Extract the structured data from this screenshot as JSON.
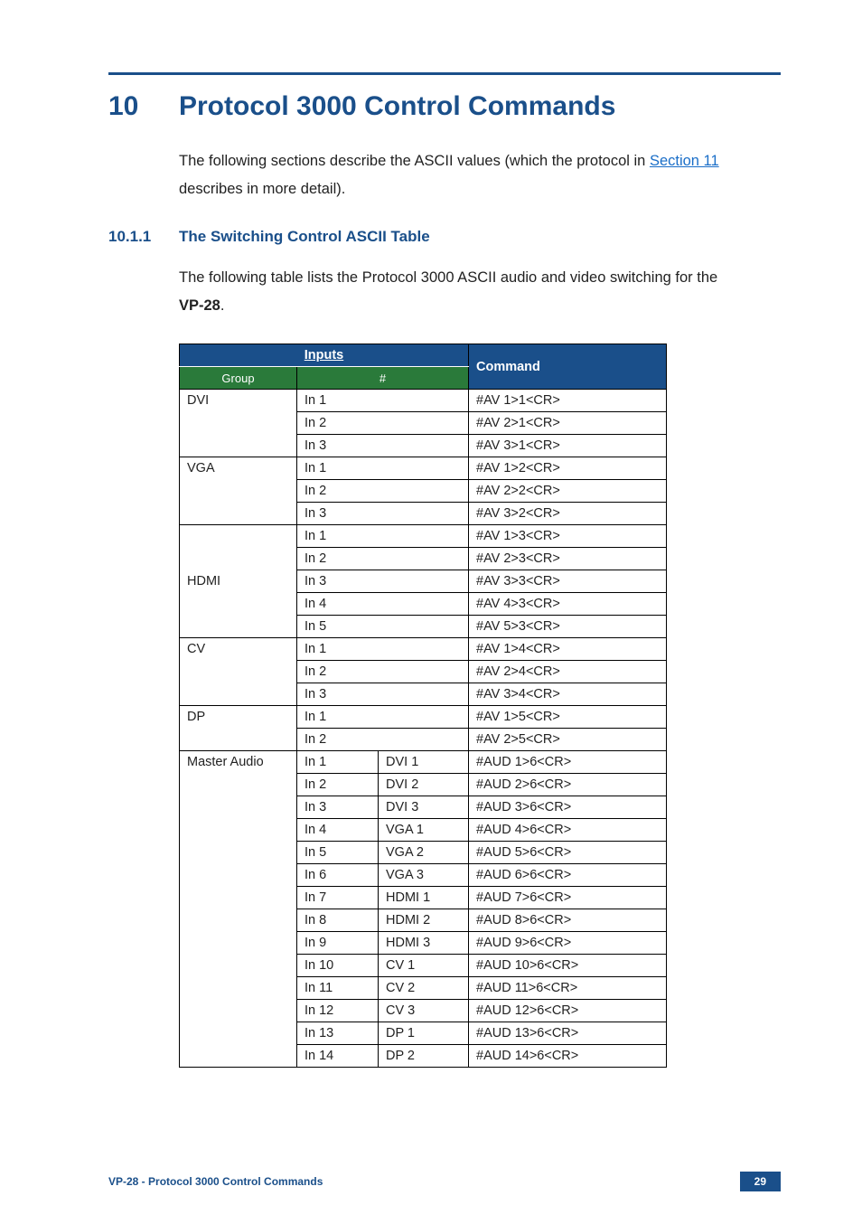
{
  "heading": {
    "num": "10",
    "title": "Protocol 3000 Control Commands"
  },
  "intro": {
    "part1": "The following sections describe the ASCII values (which the protocol in ",
    "link": "Section 11",
    "part2": " describes in more detail)."
  },
  "subheading": {
    "num": "10.1.1",
    "title": "The Switching Control ASCII Table"
  },
  "subintro": {
    "line1": "The following table lists the Protocol 3000 ASCII audio and video switching for the ",
    "bold": "VP-28",
    "dot": "."
  },
  "table": {
    "headers": {
      "inputs": "Inputs",
      "command": "Command",
      "group": "Group",
      "hash": "#"
    },
    "groups": [
      {
        "name": "DVI",
        "rows": [
          {
            "in": "In 1",
            "sub": "",
            "cmd": "#AV 1>1<CR>"
          },
          {
            "in": "In 2",
            "sub": "",
            "cmd": "#AV 2>1<CR>"
          },
          {
            "in": "In 3",
            "sub": "",
            "cmd": "#AV 3>1<CR>"
          }
        ]
      },
      {
        "name": "VGA",
        "rows": [
          {
            "in": "In 1",
            "sub": "",
            "cmd": "#AV 1>2<CR>"
          },
          {
            "in": "In 2",
            "sub": "",
            "cmd": "#AV 2>2<CR>"
          },
          {
            "in": "In 3",
            "sub": "",
            "cmd": "#AV 3>2<CR>"
          }
        ]
      },
      {
        "name": "HDMI",
        "rows": [
          {
            "in": "In 1",
            "sub": "",
            "cmd": "#AV 1>3<CR>"
          },
          {
            "in": "In 2",
            "sub": "",
            "cmd": "#AV 2>3<CR>"
          },
          {
            "in": "In 3",
            "sub": "",
            "cmd": "#AV 3>3<CR>"
          },
          {
            "in": "In 4",
            "sub": "",
            "cmd": "#AV 4>3<CR>"
          },
          {
            "in": "In 5",
            "sub": "",
            "cmd": "#AV 5>3<CR>"
          }
        ]
      },
      {
        "name": "CV",
        "rows": [
          {
            "in": "In 1",
            "sub": "",
            "cmd": "#AV 1>4<CR>"
          },
          {
            "in": "In 2",
            "sub": "",
            "cmd": "#AV 2>4<CR>"
          },
          {
            "in": "In 3",
            "sub": "",
            "cmd": "#AV 3>4<CR>"
          }
        ]
      },
      {
        "name": "DP",
        "rows": [
          {
            "in": "In 1",
            "sub": "",
            "cmd": "#AV 1>5<CR>"
          },
          {
            "in": "In 2",
            "sub": "",
            "cmd": "#AV 2>5<CR>"
          }
        ]
      },
      {
        "name": "Master Audio",
        "rows": [
          {
            "in": "In 1",
            "sub": "DVI 1",
            "cmd": "#AUD 1>6<CR>"
          },
          {
            "in": "In 2",
            "sub": "DVI 2",
            "cmd": "#AUD 2>6<CR>"
          },
          {
            "in": "In 3",
            "sub": "DVI 3",
            "cmd": "#AUD 3>6<CR>"
          },
          {
            "in": "In 4",
            "sub": "VGA 1",
            "cmd": "#AUD 4>6<CR>"
          },
          {
            "in": "In 5",
            "sub": "VGA 2",
            "cmd": "#AUD 5>6<CR>"
          },
          {
            "in": "In 6",
            "sub": "VGA 3",
            "cmd": "#AUD 6>6<CR>"
          },
          {
            "in": "In 7",
            "sub": "HDMI 1",
            "cmd": "#AUD 7>6<CR>"
          },
          {
            "in": "In 8",
            "sub": "HDMI 2",
            "cmd": "#AUD 8>6<CR>"
          },
          {
            "in": "In 9",
            "sub": "HDMI 3",
            "cmd": "#AUD 9>6<CR>"
          },
          {
            "in": "In 10",
            "sub": "CV 1",
            "cmd": "#AUD 10>6<CR>"
          },
          {
            "in": "In 11",
            "sub": "CV 2",
            "cmd": "#AUD 11>6<CR>"
          },
          {
            "in": "In 12",
            "sub": "CV 3",
            "cmd": "#AUD 12>6<CR>"
          },
          {
            "in": "In 13",
            "sub": "DP 1",
            "cmd": "#AUD 13>6<CR>"
          },
          {
            "in": "In 14",
            "sub": "DP 2",
            "cmd": "#AUD 14>6<CR>"
          }
        ]
      }
    ]
  },
  "footer": {
    "left": "VP-28 - Protocol 3000 Control Commands",
    "page": "29"
  }
}
